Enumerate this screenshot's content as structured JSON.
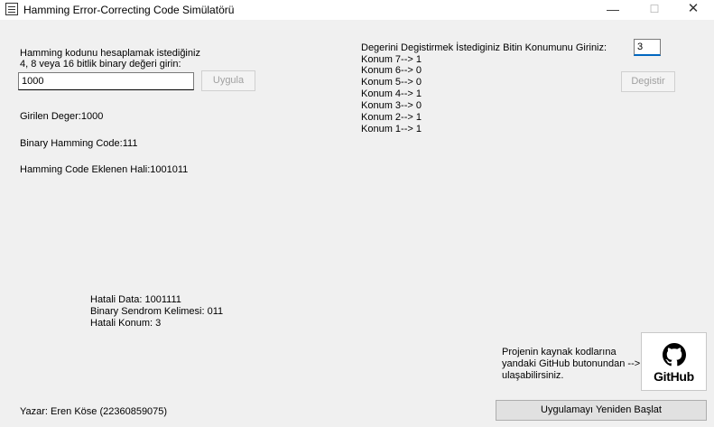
{
  "window": {
    "title": "Hamming Error-Correcting Code Simülatörü",
    "minimize": "—",
    "maximize": "☐",
    "close": "✕"
  },
  "left": {
    "prompt_line1": "Hamming kodunu hesaplamak istediğiniz",
    "prompt_line2": "4, 8 veya 16 bitlik binary değeri girin:",
    "input_value": "1000",
    "apply_button": "Uygula",
    "entered_value": "Girilen Deger:1000",
    "binary_hamming": "Binary Hamming Code:111",
    "hamming_added": "Hamming Code Eklenen Hali:1001011"
  },
  "right": {
    "prompt": "Degerini Degistirmek İstediginiz Bitin Konumunu Giriniz:",
    "position_input": "3",
    "change_button": "Degistir",
    "positions": [
      "Konum 7--> 1",
      "Konum 6--> 0",
      "Konum 5--> 0",
      "Konum 4--> 1",
      "Konum 3--> 0",
      "Konum 2--> 1",
      "Konum 1--> 1"
    ]
  },
  "result": {
    "faulty_data": "Hatali Data: 1001111",
    "syndrome": "Binary Sendrom Kelimesi: 011",
    "faulty_position": "Hatali Konum: 3"
  },
  "source": {
    "line1": "Projenin kaynak kodlarına",
    "line2": "yandaki GitHub butonundan -->",
    "line3": "ulaşabilirsiniz.",
    "github_label": "GitHub"
  },
  "footer": {
    "author": "Yazar: Eren Köse (22360859075)",
    "restart_button": "Uygulamayı Yeniden Başlat"
  }
}
